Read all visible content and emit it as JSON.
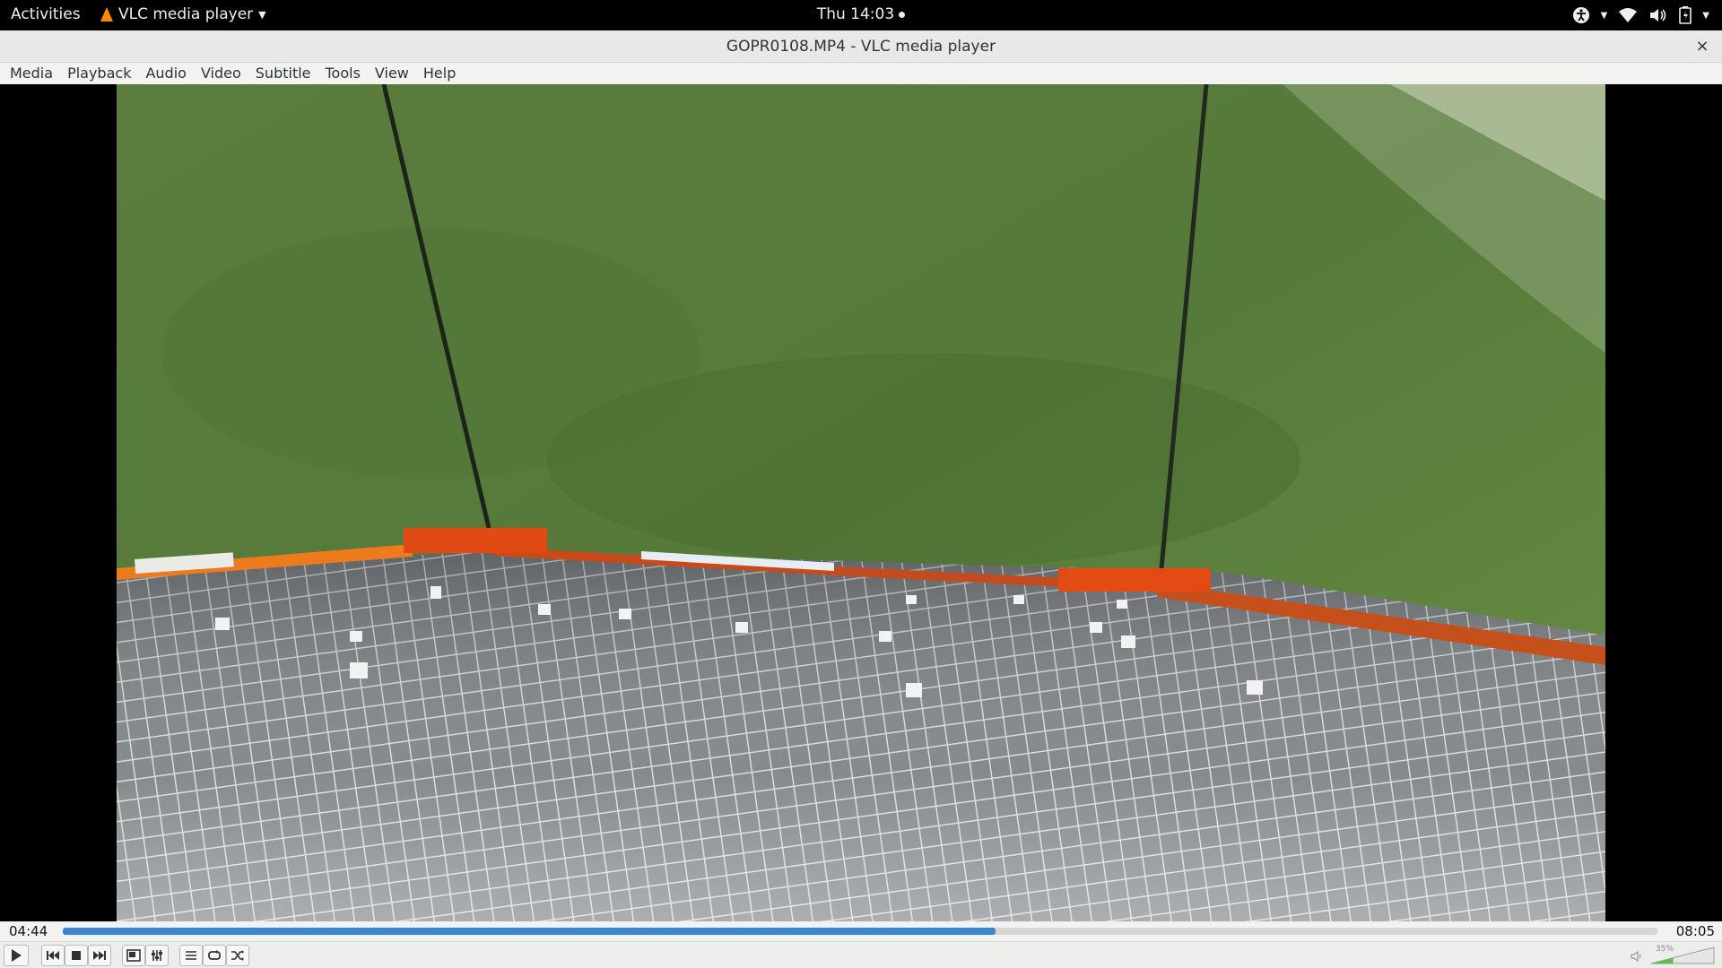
{
  "topbar": {
    "activities": "Activities",
    "app_name": "VLC media player",
    "clock": "Thu 14:03",
    "tray_icons": [
      "accessibility-icon",
      "wifi-icon",
      "volume-icon",
      "battery-icon"
    ]
  },
  "window": {
    "title": "GOPR0108.MP4 - VLC media player",
    "close": "×"
  },
  "menubar": {
    "items": [
      "Media",
      "Playback",
      "Audio",
      "Video",
      "Subtitle",
      "Tools",
      "View",
      "Help"
    ]
  },
  "player": {
    "time_current": "04:44",
    "time_total": "08:05",
    "progress_fraction": 0.585,
    "volume_label": "35%",
    "volume_fraction": 0.35
  },
  "colors": {
    "accent": "#3a86d3",
    "vlc_cone": "#ff8800"
  },
  "controls": [
    "play-icon",
    "previous-icon",
    "stop-icon",
    "next-icon",
    "fullscreen-icon",
    "extended-settings-icon",
    "playlist-icon",
    "loop-icon",
    "shuffle-icon"
  ]
}
